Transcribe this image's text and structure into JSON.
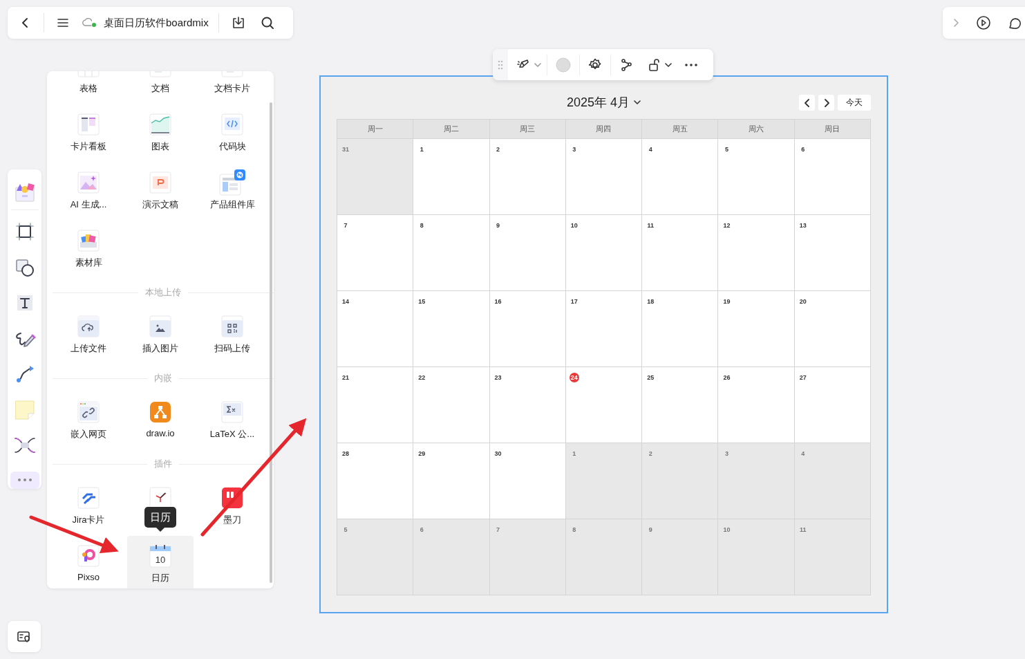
{
  "top_bar": {
    "title": "桌面日历软件boardmix"
  },
  "tool_rail": [
    {
      "kind": "materials",
      "selected": false
    },
    {
      "kind": "frame",
      "selected": false
    },
    {
      "kind": "shape",
      "selected": false
    },
    {
      "kind": "text",
      "selected": false
    },
    {
      "kind": "pen",
      "selected": false
    },
    {
      "kind": "connector",
      "selected": false
    },
    {
      "kind": "sticky",
      "selected": false
    },
    {
      "kind": "mindmap",
      "selected": false
    },
    {
      "kind": "more",
      "selected": true
    }
  ],
  "insert_panel": {
    "sections": [
      {
        "items": [
          {
            "label": "表格",
            "kind": "table",
            "selected": false
          },
          {
            "label": "文档",
            "kind": "doc",
            "selected": false
          },
          {
            "label": "文档卡片",
            "kind": "doc",
            "selected": false
          },
          {
            "label": "卡片看板",
            "kind": "kanban",
            "selected": false
          },
          {
            "label": "图表",
            "kind": "chart",
            "selected": false
          },
          {
            "label": "代码块",
            "kind": "code",
            "selected": false
          },
          {
            "label": "AI 生成...",
            "kind": "ai",
            "selected": false
          },
          {
            "label": "演示文稿",
            "kind": "slides",
            "selected": false
          },
          {
            "label": "产品组件库",
            "kind": "components",
            "selected": false
          },
          {
            "label": "素材库",
            "kind": "materials",
            "selected": false
          }
        ]
      },
      {
        "heading": "本地上传",
        "items": [
          {
            "label": "上传文件",
            "kind": "upload",
            "selected": false
          },
          {
            "label": "插入图片",
            "kind": "image",
            "selected": false
          },
          {
            "label": "扫码上传",
            "kind": "qr",
            "selected": false
          }
        ]
      },
      {
        "heading": "内嵌",
        "items": [
          {
            "label": "嵌入网页",
            "kind": "web",
            "selected": false
          },
          {
            "label": "draw.io",
            "kind": "drawio",
            "selected": false
          },
          {
            "label": "LaTeX 公...",
            "kind": "latex",
            "selected": false
          }
        ]
      },
      {
        "heading": "插件",
        "items": [
          {
            "label": "Jira卡片",
            "kind": "jira",
            "selected": false
          },
          {
            "kind": "clock",
            "selected": false
          },
          {
            "label": "墨刀",
            "kind": "modao",
            "selected": false
          },
          {
            "label": "Pixso",
            "kind": "pixso",
            "selected": false
          },
          {
            "label": "日历",
            "kind": "calendar",
            "selected": true
          }
        ]
      }
    ],
    "tooltip": "日历",
    "calendar_icon_day": "10"
  },
  "calendar": {
    "title": "2025年 4月",
    "today_button": "今天",
    "weekdays": [
      "周一",
      "周二",
      "周三",
      "周四",
      "周五",
      "周六",
      "周日"
    ],
    "weeks": [
      [
        {
          "day": "31",
          "in_month": false,
          "today": false
        },
        {
          "day": "1",
          "in_month": true,
          "today": false
        },
        {
          "day": "2",
          "in_month": true,
          "today": false
        },
        {
          "day": "3",
          "in_month": true,
          "today": false
        },
        {
          "day": "4",
          "in_month": true,
          "today": false
        },
        {
          "day": "5",
          "in_month": true,
          "today": false
        },
        {
          "day": "6",
          "in_month": true,
          "today": false
        }
      ],
      [
        {
          "day": "7",
          "in_month": true,
          "today": false
        },
        {
          "day": "8",
          "in_month": true,
          "today": false
        },
        {
          "day": "9",
          "in_month": true,
          "today": false
        },
        {
          "day": "10",
          "in_month": true,
          "today": false
        },
        {
          "day": "11",
          "in_month": true,
          "today": false
        },
        {
          "day": "12",
          "in_month": true,
          "today": false
        },
        {
          "day": "13",
          "in_month": true,
          "today": false
        }
      ],
      [
        {
          "day": "14",
          "in_month": true,
          "today": false
        },
        {
          "day": "15",
          "in_month": true,
          "today": false
        },
        {
          "day": "16",
          "in_month": true,
          "today": false
        },
        {
          "day": "17",
          "in_month": true,
          "today": false
        },
        {
          "day": "18",
          "in_month": true,
          "today": false
        },
        {
          "day": "19",
          "in_month": true,
          "today": false
        },
        {
          "day": "20",
          "in_month": true,
          "today": false
        }
      ],
      [
        {
          "day": "21",
          "in_month": true,
          "today": false
        },
        {
          "day": "22",
          "in_month": true,
          "today": false
        },
        {
          "day": "23",
          "in_month": true,
          "today": false
        },
        {
          "day": "24",
          "in_month": true,
          "today": true
        },
        {
          "day": "25",
          "in_month": true,
          "today": false
        },
        {
          "day": "26",
          "in_month": true,
          "today": false
        },
        {
          "day": "27",
          "in_month": true,
          "today": false
        }
      ],
      [
        {
          "day": "28",
          "in_month": true,
          "today": false
        },
        {
          "day": "29",
          "in_month": true,
          "today": false
        },
        {
          "day": "30",
          "in_month": true,
          "today": false
        },
        {
          "day": "1",
          "in_month": false,
          "today": false
        },
        {
          "day": "2",
          "in_month": false,
          "today": false
        },
        {
          "day": "3",
          "in_month": false,
          "today": false
        },
        {
          "day": "4",
          "in_month": false,
          "today": false
        }
      ],
      [
        {
          "day": "5",
          "in_month": false,
          "today": false
        },
        {
          "day": "6",
          "in_month": false,
          "today": false
        },
        {
          "day": "7",
          "in_month": false,
          "today": false
        },
        {
          "day": "8",
          "in_month": false,
          "today": false
        },
        {
          "day": "9",
          "in_month": false,
          "today": false
        },
        {
          "day": "10",
          "in_month": false,
          "today": false
        },
        {
          "day": "11",
          "in_month": false,
          "today": false
        }
      ]
    ]
  }
}
